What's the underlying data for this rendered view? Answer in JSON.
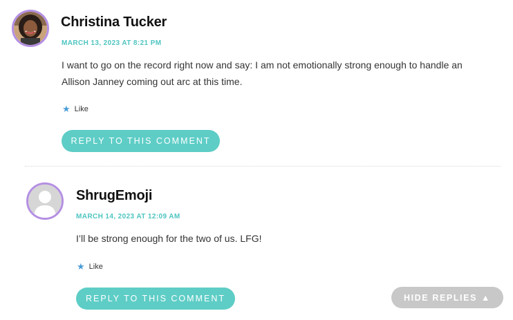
{
  "comments": [
    {
      "author": "Christina Tucker",
      "date": "MARCH 13, 2023 AT 8:21 PM",
      "body": "I want to go on the record right now and say: I am not emotionally strong enough to handle an Allison Janney coming out arc at this time.",
      "like_label": "Like",
      "reply_label": "REPLY TO THIS COMMENT"
    },
    {
      "author": "ShrugEmoji",
      "date": "MARCH 14, 2023 AT 12:09 AM",
      "body": "I’ll be strong enough for the two of us. LFG!",
      "like_label": "Like",
      "reply_label": "REPLY TO THIS COMMENT"
    }
  ],
  "hide_replies": {
    "label": "HIDE REPLIES",
    "icon": "triangle-up-icon",
    "glyph": "▲"
  },
  "colors": {
    "accent": "#4ec5c1",
    "button": "#5ecdc6",
    "avatar_border": "#b48fe3",
    "like_star": "#4a9cd6",
    "hide_button": "#c8c8c8"
  }
}
